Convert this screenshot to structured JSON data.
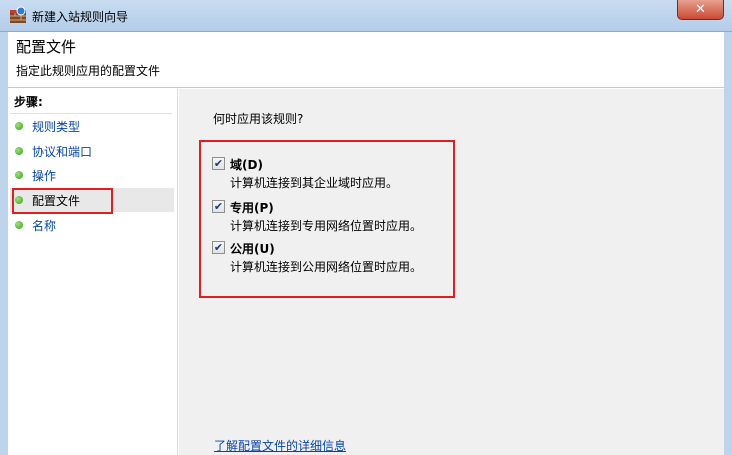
{
  "window": {
    "title": "新建入站规则向导",
    "close_label": "✕"
  },
  "header": {
    "title": "配置文件",
    "subtitle": "指定此规则应用的配置文件"
  },
  "sidebar": {
    "steps_label": "步骤:",
    "items": [
      {
        "label": "规则类型"
      },
      {
        "label": "协议和端口"
      },
      {
        "label": "操作"
      },
      {
        "label": "配置文件"
      },
      {
        "label": "名称"
      }
    ]
  },
  "main": {
    "question": "何时应用该规则?",
    "options": [
      {
        "label": "域(D)",
        "description": "计算机连接到其企业域时应用。",
        "checked": true
      },
      {
        "label": "专用(P)",
        "description": "计算机连接到专用网络位置时应用。",
        "checked": true
      },
      {
        "label": "公用(U)",
        "description": "计算机连接到公用网络位置时应用。",
        "checked": true
      }
    ],
    "learn_more": "了解配置文件的详细信息"
  }
}
